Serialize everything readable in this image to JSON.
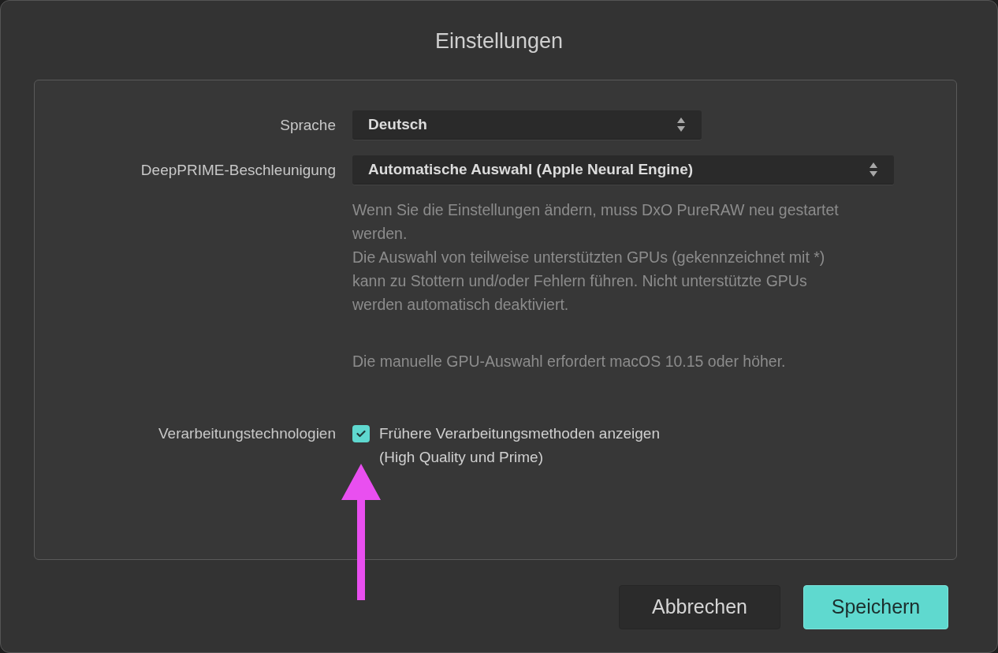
{
  "window": {
    "title": "Einstellungen"
  },
  "settings": [
    {
      "kind": "select",
      "label": "Sprache",
      "value": "Deutsch"
    },
    {
      "kind": "select",
      "label": "DeepPRIME-Beschleunigung",
      "value": "Automatische Auswahl (Apple Neural Engine)"
    },
    {
      "kind": "help",
      "paragraphs": [
        "Wenn Sie die Einstellungen ändern, muss DxO PureRAW neu gestartet werden.",
        "Die Auswahl von teilweise unterstützten GPUs (gekennzeichnet mit *) kann zu Stottern und/oder Fehlern führen. Nicht unterstützte GPUs werden automatisch deaktiviert."
      ]
    },
    {
      "kind": "help",
      "paragraphs": [
        "Die manuelle GPU-Auswahl erfordert macOS 10.15 oder höher."
      ]
    },
    {
      "kind": "checkbox",
      "label": "Verarbeitungstechnologien",
      "text": "Frühere Verarbeitungsmethoden anzeigen\n(High Quality und Prime)",
      "checked": true
    }
  ],
  "buttons": [
    {
      "label": "Abbrechen",
      "kind": "secondary"
    },
    {
      "label": "Speichern",
      "kind": "primary"
    }
  ]
}
